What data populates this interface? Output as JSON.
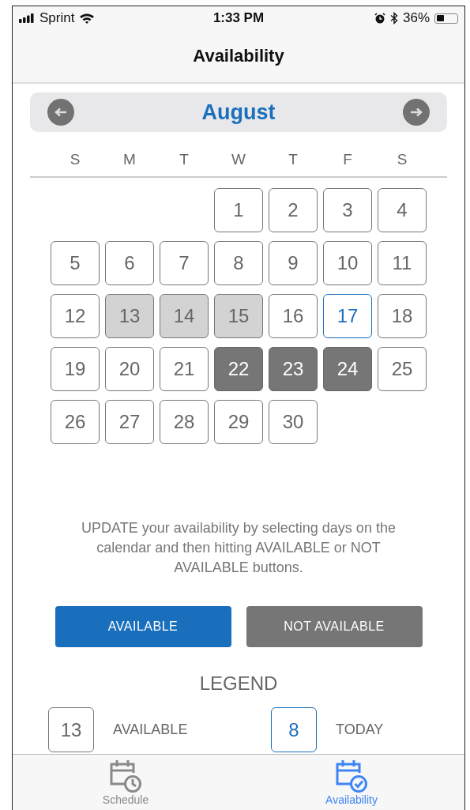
{
  "status_bar": {
    "carrier": "Sprint",
    "time": "1:33 PM",
    "battery": "36%"
  },
  "nav": {
    "title": "Availability"
  },
  "calendar": {
    "month": "August",
    "weekdays": [
      "S",
      "M",
      "T",
      "W",
      "T",
      "F",
      "S"
    ],
    "weeks": [
      [
        {
          "kind": "blank"
        },
        {
          "kind": "blank"
        },
        {
          "kind": "blank"
        },
        {
          "day": "1",
          "kind": "available"
        },
        {
          "day": "2",
          "kind": "available"
        },
        {
          "day": "3",
          "kind": "available"
        },
        {
          "day": "4",
          "kind": "available"
        }
      ],
      [
        {
          "day": "5",
          "kind": "available"
        },
        {
          "day": "6",
          "kind": "available"
        },
        {
          "day": "7",
          "kind": "available"
        },
        {
          "day": "8",
          "kind": "available"
        },
        {
          "day": "9",
          "kind": "available"
        },
        {
          "day": "10",
          "kind": "available"
        },
        {
          "day": "11",
          "kind": "available"
        }
      ],
      [
        {
          "day": "12",
          "kind": "available"
        },
        {
          "day": "13",
          "kind": "selected"
        },
        {
          "day": "14",
          "kind": "selected"
        },
        {
          "day": "15",
          "kind": "selected"
        },
        {
          "day": "16",
          "kind": "available"
        },
        {
          "day": "17",
          "kind": "today"
        },
        {
          "day": "18",
          "kind": "available"
        }
      ],
      [
        {
          "day": "19",
          "kind": "available"
        },
        {
          "day": "20",
          "kind": "available"
        },
        {
          "day": "21",
          "kind": "available"
        },
        {
          "day": "22",
          "kind": "unavailable"
        },
        {
          "day": "23",
          "kind": "unavailable"
        },
        {
          "day": "24",
          "kind": "unavailable"
        },
        {
          "day": "25",
          "kind": "available"
        }
      ],
      [
        {
          "day": "26",
          "kind": "available"
        },
        {
          "day": "27",
          "kind": "available"
        },
        {
          "day": "28",
          "kind": "available"
        },
        {
          "day": "29",
          "kind": "available"
        },
        {
          "day": "30",
          "kind": "available"
        },
        {
          "kind": "blank"
        },
        {
          "kind": "blank"
        }
      ]
    ]
  },
  "instructions": "UPDATE your availability by selecting days on the calendar and then hitting AVAILABLE or NOT AVAILABLE buttons.",
  "buttons": [
    {
      "label": "AVAILABLE",
      "kind": "available"
    },
    {
      "label": "NOT AVAILABLE",
      "kind": "unavailable"
    }
  ],
  "legend": {
    "title": "LEGEND",
    "items": [
      {
        "sample": "13",
        "label": "AVAILABLE",
        "kind": "available"
      },
      {
        "sample": "8",
        "label": "TODAY",
        "kind": "today"
      }
    ]
  },
  "tab_bar": [
    {
      "label": "Schedule",
      "selected": false
    },
    {
      "label": "Availability",
      "selected": true
    }
  ]
}
